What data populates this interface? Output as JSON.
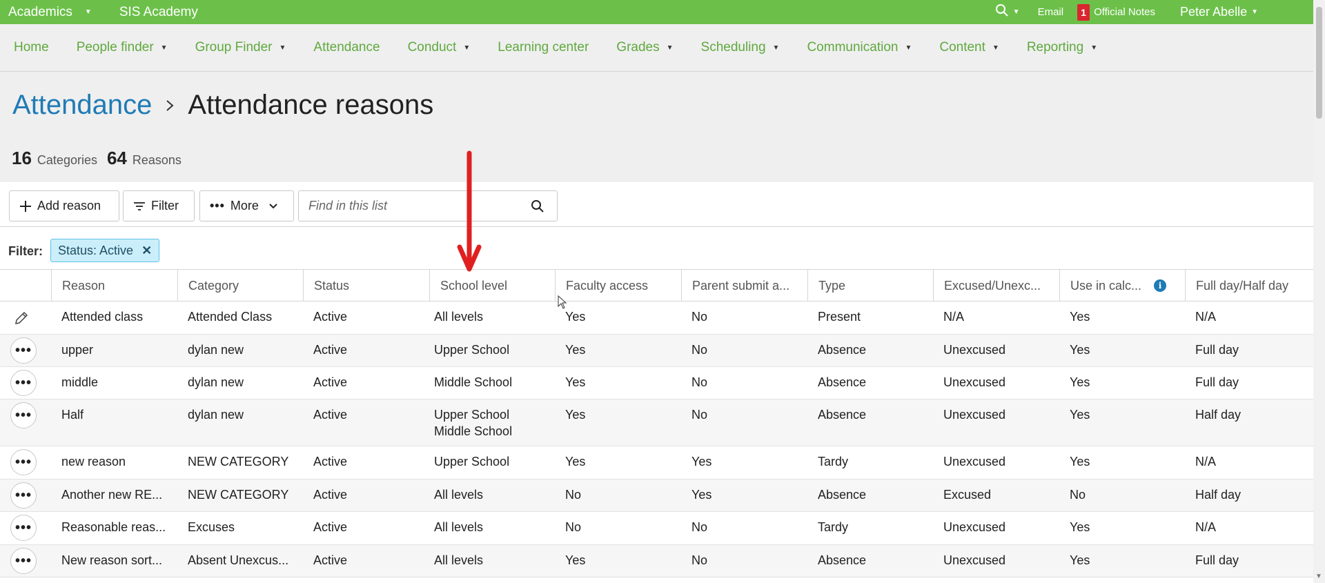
{
  "topbar": {
    "app_label": "Academics",
    "school_name": "SIS Academy",
    "email_label": "Email",
    "notes_count": "1",
    "notes_label": "Official Notes",
    "user_name": "Peter Abelle"
  },
  "nav": {
    "items": [
      {
        "label": "Home",
        "dropdown": false
      },
      {
        "label": "People finder",
        "dropdown": true
      },
      {
        "label": "Group Finder",
        "dropdown": true
      },
      {
        "label": "Attendance",
        "dropdown": false
      },
      {
        "label": "Conduct",
        "dropdown": true
      },
      {
        "label": "Learning center",
        "dropdown": false
      },
      {
        "label": "Grades",
        "dropdown": true
      },
      {
        "label": "Scheduling",
        "dropdown": true
      },
      {
        "label": "Communication",
        "dropdown": true
      },
      {
        "label": "Content",
        "dropdown": true
      },
      {
        "label": "Reporting",
        "dropdown": true
      }
    ]
  },
  "breadcrumb": {
    "parent": "Attendance",
    "title": "Attendance reasons"
  },
  "stats": {
    "categories_count": "16",
    "categories_label": "Categories",
    "reasons_count": "64",
    "reasons_label": "Reasons"
  },
  "toolbar": {
    "add_label": "Add reason",
    "filter_label": "Filter",
    "more_label": "More",
    "search_placeholder": "Find in this list"
  },
  "filter": {
    "label": "Filter:",
    "chip": "Status: Active"
  },
  "table": {
    "columns": [
      "Reason",
      "Category",
      "Status",
      "School level",
      "Faculty access",
      "Parent submit a...",
      "Type",
      "Excused/Unexc...",
      "Use in calc...",
      "Full day/Half day"
    ],
    "rows": [
      {
        "action": "edit",
        "cells": [
          "Attended class",
          "Attended Class",
          "Active",
          "All levels",
          "Yes",
          "No",
          "Present",
          "N/A",
          "Yes",
          "N/A"
        ]
      },
      {
        "action": "more",
        "cells": [
          "upper",
          "dylan new",
          "Active",
          "Upper School",
          "Yes",
          "No",
          "Absence",
          "Unexcused",
          "Yes",
          "Full day"
        ]
      },
      {
        "action": "more",
        "cells": [
          "middle",
          "dylan new",
          "Active",
          "Middle School",
          "Yes",
          "No",
          "Absence",
          "Unexcused",
          "Yes",
          "Full day"
        ]
      },
      {
        "action": "more",
        "cells": [
          "Half",
          "dylan new",
          "Active",
          "Upper School\nMiddle School",
          "Yes",
          "No",
          "Absence",
          "Unexcused",
          "Yes",
          "Half day"
        ]
      },
      {
        "action": "more",
        "cells": [
          "new reason",
          "NEW CATEGORY",
          "Active",
          "Upper School",
          "Yes",
          "Yes",
          "Tardy",
          "Unexcused",
          "Yes",
          "N/A"
        ]
      },
      {
        "action": "more",
        "cells": [
          "Another new RE...",
          "NEW CATEGORY",
          "Active",
          "All levels",
          "No",
          "Yes",
          "Absence",
          "Excused",
          "No",
          "Half day"
        ]
      },
      {
        "action": "more",
        "cells": [
          "Reasonable reas...",
          "Excuses",
          "Active",
          "All levels",
          "No",
          "No",
          "Tardy",
          "Unexcused",
          "Yes",
          "N/A"
        ]
      },
      {
        "action": "more",
        "cells": [
          "New reason sort...",
          "Absent Unexcus...",
          "Active",
          "All levels",
          "Yes",
          "No",
          "Absence",
          "Unexcused",
          "Yes",
          "Full day"
        ]
      }
    ]
  },
  "colors": {
    "topbar": "#6cc04a",
    "nav_link": "#5fa93e",
    "breadcrumb_link": "#1f7bb5",
    "chip_bg": "#cbeefb",
    "annotation_arrow": "#e02020"
  }
}
